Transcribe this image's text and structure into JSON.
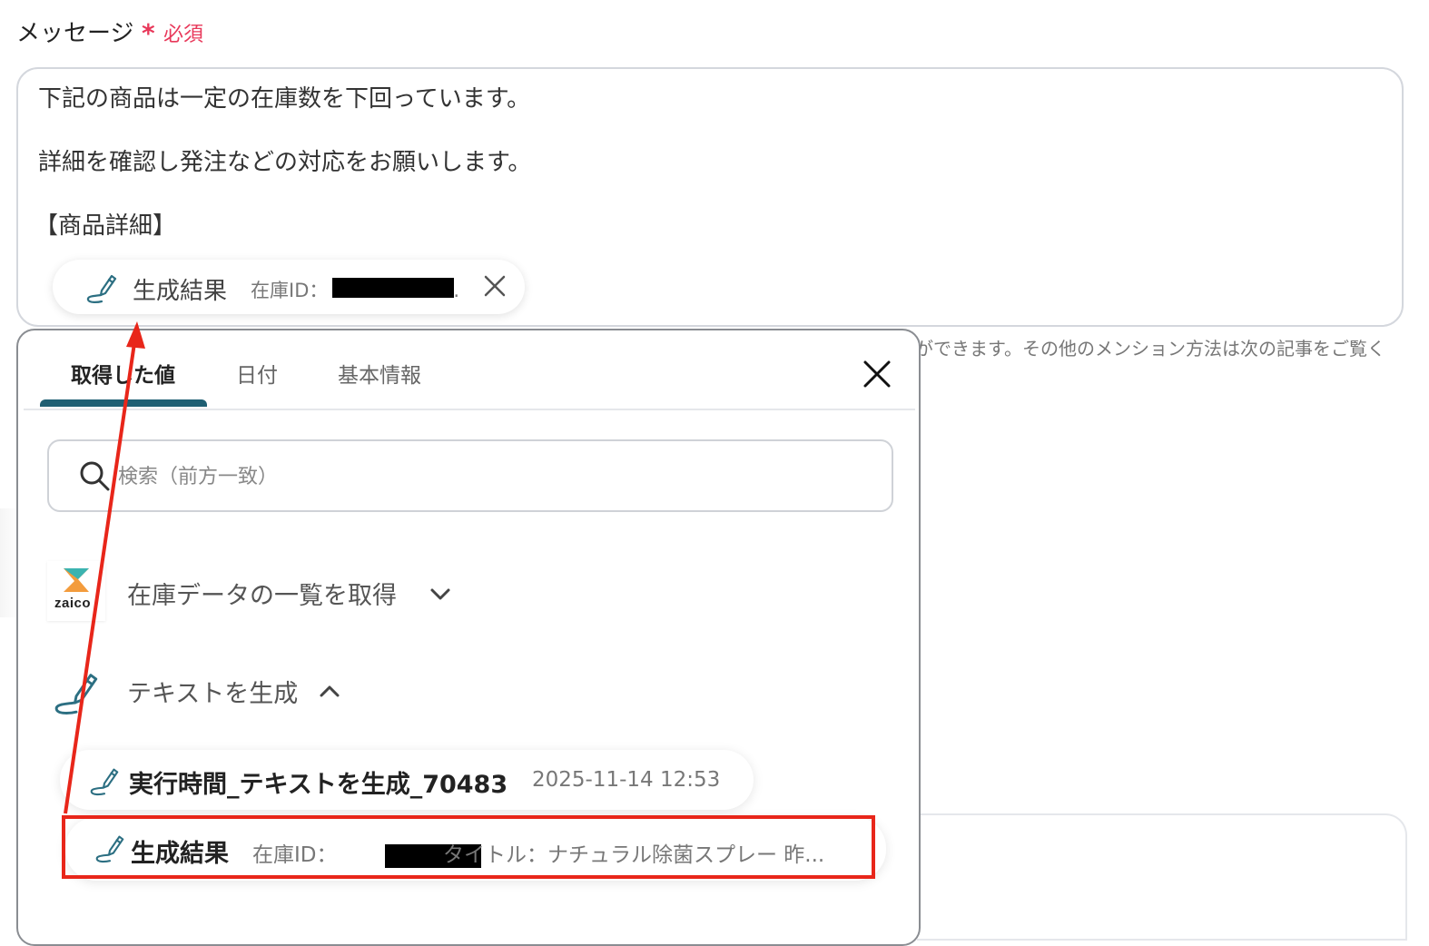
{
  "field": {
    "label": "メッセージ",
    "required_mark": "*",
    "required_text": "必須"
  },
  "message": {
    "lines": [
      "下記の商品は一定の在庫数を下回っています。",
      "詳細を確認し発注などの対応をお願いします。",
      "【商品詳細】"
    ],
    "chip": {
      "icon": "pen-icon",
      "name": "生成結果",
      "detail": "在庫ID：",
      "detail_tail": ".",
      "close_icon": "close-icon"
    }
  },
  "hint": "ができます。その他のメンション方法は次の記事をご覧く",
  "popup": {
    "tabs": [
      "取得した値",
      "日付",
      "基本情報"
    ],
    "active_tab": 0,
    "search": {
      "placeholder": "検索（前方一致）",
      "value": ""
    },
    "sections": [
      {
        "logo": "zaico",
        "title": "在庫データの一覧を取得",
        "state_icon": "chevron-down-icon"
      },
      {
        "logo": "pen-icon",
        "title": "テキストを生成",
        "state_icon": "chevron-up-icon"
      }
    ],
    "items": [
      {
        "name": "実行時間_テキストを生成_70483",
        "value": "2025-11-14 12:53"
      },
      {
        "name": "生成結果",
        "value_prefix": "在庫ID：",
        "value_suffix": "タイトル：ナチュラル除菌スプレー 昨..."
      }
    ]
  },
  "annotation_colors": {
    "highlight": "#e8261a",
    "tab_accent": "#1f5f73",
    "required": "#e8385a"
  }
}
